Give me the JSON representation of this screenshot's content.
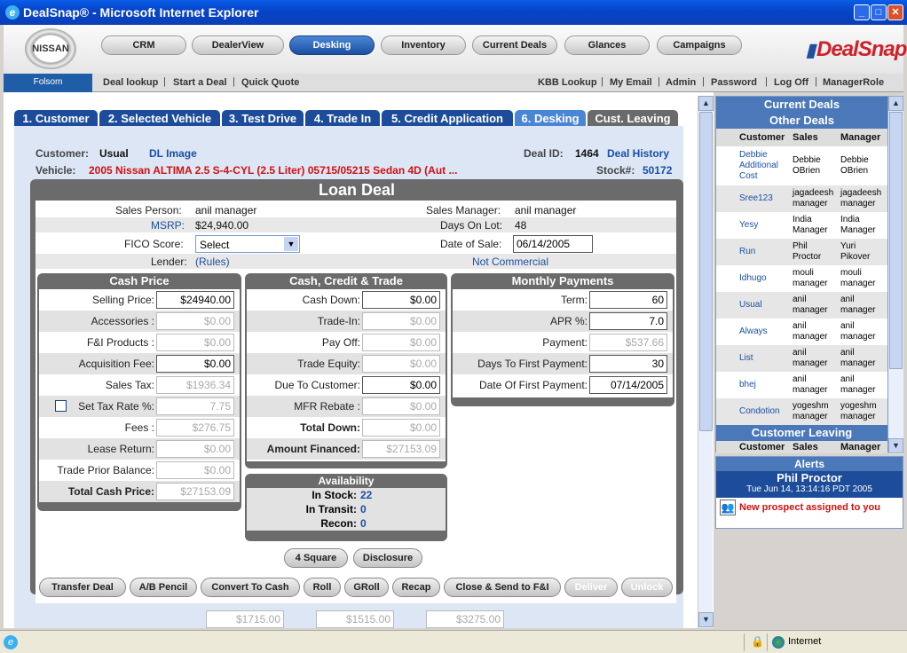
{
  "window": {
    "title": "DealSnap® - Microsoft Internet Explorer"
  },
  "header": {
    "brand": "DealSnap",
    "logo_text": "NISSAN",
    "nav": [
      {
        "label": "CRM"
      },
      {
        "label": "DealerView"
      },
      {
        "label": "Desking"
      },
      {
        "label": "Inventory"
      },
      {
        "label": "Current Deals"
      },
      {
        "label": "Glances"
      },
      {
        "label": "Campaigns"
      }
    ]
  },
  "subnav": {
    "location": "Folsom",
    "links": [
      "Deal lookup",
      "Start a Deal",
      "Quick Quote"
    ],
    "right_links": [
      "KBB Lookup",
      "My Email",
      "Admin",
      "Password",
      "Log Off",
      "ManagerRole"
    ]
  },
  "tabs": [
    "1. Customer",
    "2. Selected Vehicle",
    "3. Test Drive",
    "4. Trade In",
    "5. Credit Application",
    "6. Desking",
    "Cust. Leaving"
  ],
  "deal": {
    "customer_label": "Customer:",
    "customer": "Usual",
    "dl_image": "DL Image",
    "deal_id_label": "Deal ID:",
    "deal_id": "1464",
    "deal_history": "Deal History",
    "vehicle_label": "Vehicle:",
    "vehicle": "2005 Nissan ALTIMA 2.5 S-4-CYL (2.5 Liter) 05715/05215 Sedan 4D (Aut ...",
    "stock_label": "Stock#:",
    "stock": "50172"
  },
  "loan": {
    "title": "Loan Deal",
    "sales_person_label": "Sales Person:",
    "sales_person": "anil manager",
    "sales_manager_label": "Sales Manager:",
    "sales_manager": "anil manager",
    "msrp_label": "MSRP:",
    "msrp": "$24,940.00",
    "days_on_lot_label": "Days On Lot:",
    "days_on_lot": "48",
    "fico_label": "FICO Score:",
    "fico_value": "Select",
    "date_of_sale_label": "Date of Sale:",
    "date_of_sale": "06/14/2005",
    "lender_label": "Lender:",
    "lender_rules": "(Rules)",
    "not_commercial": "Not Commercial"
  },
  "cash_price": {
    "title": "Cash Price",
    "rows": [
      {
        "label": "Selling Price:",
        "value": "$24940.00"
      },
      {
        "label": "Accessories :",
        "value": "$0.00"
      },
      {
        "label": "F&I Products :",
        "value": "$0.00"
      },
      {
        "label": "Acquisition Fee:",
        "value": "$0.00"
      },
      {
        "label": "Sales Tax:",
        "value": "$1936.34"
      },
      {
        "label": "Set Tax Rate %:",
        "value": "7.75"
      },
      {
        "label": "Fees :",
        "value": "$276.75"
      },
      {
        "label": "Lease Return:",
        "value": "$0.00"
      },
      {
        "label": "Trade Prior Balance:",
        "value": "$0.00"
      },
      {
        "label": "Total Cash Price:",
        "value": "$27153.09"
      }
    ]
  },
  "cash_credit": {
    "title": "Cash, Credit & Trade",
    "rows": [
      {
        "label": "Cash Down:",
        "value": "$0.00"
      },
      {
        "label": "Trade-In:",
        "value": "$0.00"
      },
      {
        "label": "Pay Off:",
        "value": "$0.00"
      },
      {
        "label": "Trade Equity:",
        "value": "$0.00"
      },
      {
        "label": "Due To Customer:",
        "value": "$0.00"
      },
      {
        "label": "MFR Rebate :",
        "value": "$0.00"
      },
      {
        "label": "Total Down:",
        "value": "$0.00"
      },
      {
        "label": "Amount Financed:",
        "value": "$27153.09"
      }
    ]
  },
  "monthly": {
    "title": "Monthly Payments",
    "rows": [
      {
        "label": "Term:",
        "value": "60"
      },
      {
        "label": "APR %:",
        "value": "7.0"
      },
      {
        "label": "Payment:",
        "value": "$537.66"
      },
      {
        "label": "Days To First Payment:",
        "value": "30"
      },
      {
        "label": "Date Of First Payment:",
        "value": "07/14/2005"
      }
    ]
  },
  "availability": {
    "title": "Availability",
    "in_stock_label": "In Stock:",
    "in_stock": "22",
    "in_transit_label": "In Transit:",
    "in_transit": "0",
    "recon_label": "Recon:",
    "recon": "0"
  },
  "buttons": {
    "four_square": "4 Square",
    "disclosure": "Disclosure",
    "actions": [
      "Transfer Deal",
      "A/B Pencil",
      "Convert To Cash",
      "Roll",
      "GRoll",
      "Recap",
      "Close & Send to F&I",
      "Deliver",
      "Unlock"
    ]
  },
  "bottom_values": [
    "$1715.00",
    "$1515.00",
    "$3275.00"
  ],
  "right_panel": {
    "current_deals": "Current Deals",
    "other_deals": "Other Deals",
    "col_customer": "Customer",
    "col_sales": "Sales",
    "col_manager": "Manager",
    "rows": [
      {
        "customer": "Debbie Additional Cost",
        "sales": "Debbie OBrien",
        "manager": "Debbie OBrien"
      },
      {
        "customer": "Sree123",
        "sales": "jagadeesh manager",
        "manager": "jagadeesh manager"
      },
      {
        "customer": "Yesy",
        "sales": "India Manager",
        "manager": "India Manager"
      },
      {
        "customer": "Run",
        "sales": "Phil Proctor",
        "manager": "Yuri Pikover"
      },
      {
        "customer": "Idhugo",
        "sales": "mouli manager",
        "manager": "mouli manager"
      },
      {
        "customer": "Usual",
        "sales": "anil manager",
        "manager": "anil manager"
      },
      {
        "customer": "Always",
        "sales": "anil manager",
        "manager": "anil manager"
      },
      {
        "customer": "List",
        "sales": "anil manager",
        "manager": "anil manager"
      },
      {
        "customer": "bhej",
        "sales": "anil manager",
        "manager": "anil manager"
      },
      {
        "customer": "Condotion",
        "sales": "yogeshm manager",
        "manager": "yogeshm manager"
      }
    ],
    "customer_leaving": "Customer Leaving"
  },
  "alerts": {
    "title": "Alerts",
    "name": "Phil Proctor",
    "time": "Tue Jun 14, 13:14:16 PDT 2005",
    "message": "New prospect assigned to you"
  },
  "status": {
    "zone": "Internet"
  }
}
